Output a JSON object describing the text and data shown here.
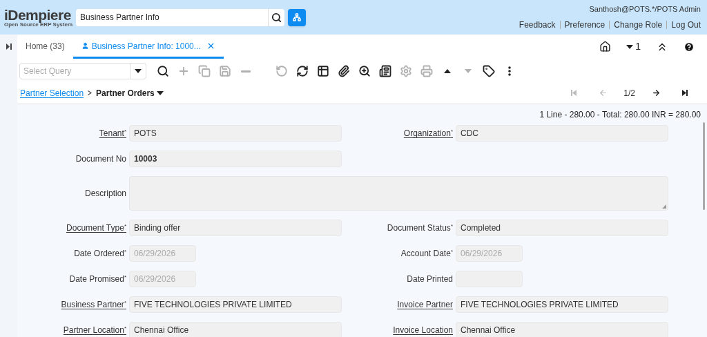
{
  "header": {
    "logo": {
      "title": "iDempiere",
      "subtitle": "Open Source ERP System"
    },
    "search": {
      "value": "Business Partner Info"
    },
    "user": "Santhosh@POTS.*/POTS Admin",
    "links": [
      "Feedback",
      "Preference",
      "Change Role",
      "Log Out"
    ]
  },
  "tabs": [
    {
      "label": "Home (33)",
      "selected": false
    },
    {
      "label": "Business Partner Info: 1000...",
      "selected": true
    }
  ],
  "window_actions": {
    "count": "1"
  },
  "toolbar": {
    "query": {
      "placeholder": "Select Query"
    },
    "buttons": [
      {
        "kind": "find",
        "disabled": false
      },
      {
        "kind": "new",
        "disabled": true
      },
      {
        "kind": "copy",
        "disabled": true
      },
      {
        "kind": "save",
        "disabled": true
      },
      {
        "kind": "delete",
        "disabled": true
      },
      {
        "kind": "undo",
        "disabled": true
      },
      {
        "kind": "refresh",
        "disabled": false
      },
      {
        "kind": "grid",
        "disabled": false
      },
      {
        "kind": "attachment",
        "disabled": false
      },
      {
        "kind": "zoom",
        "disabled": false
      },
      {
        "kind": "report",
        "disabled": false
      },
      {
        "kind": "process",
        "disabled": true
      },
      {
        "kind": "print",
        "disabled": true
      },
      {
        "kind": "parent",
        "disabled": false
      },
      {
        "kind": "child",
        "disabled": true
      },
      {
        "kind": "tag",
        "disabled": false
      },
      {
        "kind": "more",
        "disabled": false
      }
    ]
  },
  "breadcrumb": {
    "parent": "Partner Selection",
    "current": "Partner Orders"
  },
  "navigation": {
    "position": "1/2",
    "buttons": [
      {
        "kind": "first",
        "disabled": true
      },
      {
        "kind": "previous",
        "disabled": true
      },
      {
        "kind": "next",
        "disabled": false
      },
      {
        "kind": "last",
        "disabled": false
      }
    ]
  },
  "summary": "1 Line - 280.00 - Total: 280.00 INR = 280.00",
  "form": {
    "rows": [
      {
        "fields": [
          {
            "label": "Tenant$^{*}$",
            "value": "POTS",
            "kind": "text",
            "linked": true,
            "disabled": false,
            "bold": false
          },
          {
            "label": "Organization$^{*}$",
            "value": "CDC",
            "kind": "text",
            "linked": true,
            "disabled": false,
            "bold": false
          }
        ]
      },
      {
        "fields": [
          {
            "label": "Document No",
            "value": "10003",
            "kind": "text",
            "linked": false,
            "disabled": false,
            "bold": true
          }
        ]
      },
      {
        "fields": [
          {
            "label": "Description",
            "kind": "textarea",
            "linked": false
          }
        ]
      },
      {
        "fields": [
          {
            "label": "Document Type$^{*}$",
            "value": "Binding offer",
            "kind": "text",
            "linked": true,
            "disabled": false,
            "bold": false
          },
          {
            "label": "Document Status$^{*}$",
            "value": "Completed",
            "kind": "text",
            "linked": false,
            "disabled": false,
            "bold": false
          }
        ]
      },
      {
        "fields": [
          {
            "label": "Date Ordered$^{*}$",
            "value": "06/29/2026",
            "kind": "date",
            "linked": false,
            "disabled": true,
            "bold": false
          },
          {
            "label": "Account Date$^{*}$",
            "value": "06/29/2026",
            "kind": "date",
            "linked": false,
            "disabled": true,
            "bold": false
          }
        ]
      },
      {
        "fields": [
          {
            "label": "Date Promised$^{*}$",
            "value": "06/29/2026",
            "kind": "date",
            "linked": false,
            "disabled": true,
            "bold": false
          },
          {
            "label": "Date Printed",
            "kind": "date",
            "linked": false
          }
        ]
      },
      {
        "fields": [
          {
            "label": "Business Partner$^{*}$",
            "value": "FIVE TECHNOLOGIES PRIVATE LIMITED",
            "kind": "text",
            "linked": true,
            "disabled": false,
            "bold": false
          },
          {
            "label": "Invoice Partner",
            "value": "FIVE TECHNOLOGIES PRIVATE LIMITED",
            "kind": "text",
            "linked": true,
            "disabled": false,
            "bold": false
          }
        ]
      },
      {
        "fields": [
          {
            "label": "Partner Location$^{*}$",
            "value": "Chennai Office",
            "kind": "text",
            "linked": true,
            "disabled": false,
            "bold": false
          },
          {
            "label": "Invoice Location",
            "value": "Chennai Office",
            "kind": "text",
            "linked": true,
            "disabled": false,
            "bold": false
          }
        ]
      }
    ]
  }
}
